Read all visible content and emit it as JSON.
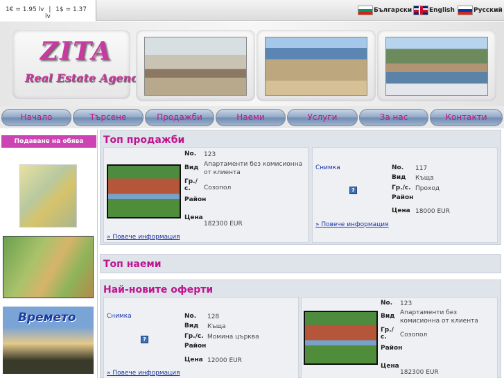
{
  "topbar": {
    "rate_eur": "1€ = 1.95 lv",
    "separator": "|",
    "rate_usd": "1$ = 1.37",
    "rate_usd_unit": "lv",
    "languages": [
      {
        "label": "Български",
        "flag": "bulgaria-flag-icon"
      },
      {
        "label": "English",
        "flag": "uk-flag-icon"
      },
      {
        "label": "Русский",
        "flag": "russia-flag-icon"
      }
    ]
  },
  "header": {
    "logo_name": "ZITA",
    "logo_tagline": "Real Estate Agency"
  },
  "nav": {
    "items": [
      "Начало",
      "Търсене",
      "Продажби",
      "Наеми",
      "Услуги",
      "За нас",
      "Контакти"
    ]
  },
  "sidebar": {
    "ad_button": "Подаване на обява",
    "weather_label": "Времето"
  },
  "labels": {
    "no": "No.",
    "type": "Вид",
    "city": "Гр./с.",
    "district": "Район",
    "price": "Цена",
    "more": "» Повече информация",
    "photo": "Снимка",
    "photo_missing": "?"
  },
  "sections": {
    "top_sales": "Топ продажби",
    "top_rentals": "Топ наеми",
    "newest": "Най-новите оферти"
  },
  "listings": {
    "top_sales": [
      {
        "no": "123",
        "type": "Апартаменти без комисионна от клиента",
        "city": "Созопол",
        "district": "",
        "price": "182300 EUR"
      },
      {
        "no": "117",
        "type": "Къща",
        "city": "Проход",
        "district": "",
        "price": "18000 EUR"
      }
    ],
    "newest": [
      {
        "no": "128",
        "type": "Къща",
        "city": "Момина църква",
        "district": "",
        "price": "12000 EUR"
      },
      {
        "no": "123",
        "type": "Апартаменти без комисионна от клиента",
        "city": "Созопол",
        "district": "",
        "price": "182300 EUR"
      }
    ]
  },
  "colors": {
    "accent_pink": "#c0148f",
    "link_blue": "#1a33a8",
    "section_bg": "#dfe3ea"
  }
}
